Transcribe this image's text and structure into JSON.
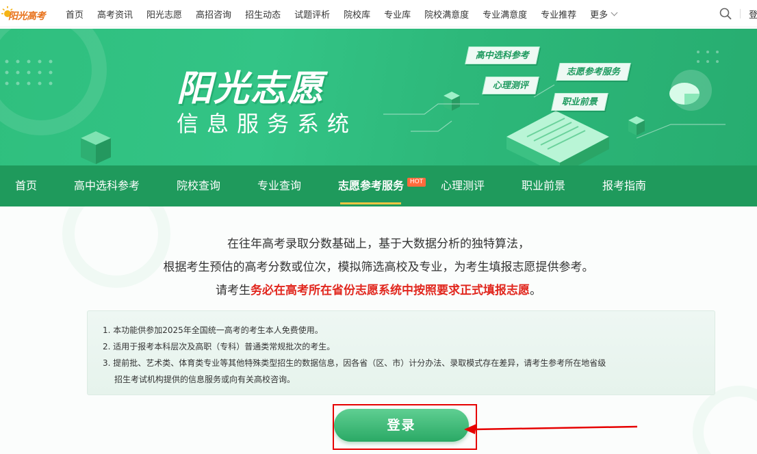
{
  "colors": {
    "brand_green": "#1f9a5c",
    "banner_green": "#33c486",
    "accent_yellow": "#f6c343",
    "hot_orange": "#ff6b3d",
    "warning_red": "#e1271e",
    "annotation_red": "#e60000"
  },
  "topbar": {
    "logo_text": "阳光高考",
    "nav": [
      "首页",
      "高考资讯",
      "阳光志愿",
      "高招咨询",
      "招生动态",
      "试题评析",
      "院校库",
      "专业库",
      "院校满意度",
      "专业满意度",
      "专业推荐"
    ],
    "more_label": "更多",
    "more_icon": "chevron-down-icon",
    "search_icon": "search-icon",
    "login_label": "登"
  },
  "banner": {
    "title": "阳光志愿",
    "subtitle": "信息服务系统",
    "tags": [
      "高中选科参考",
      "心理测评",
      "志愿参考服务",
      "职业前景"
    ]
  },
  "mainnav": {
    "items": [
      "首页",
      "高中选科参考",
      "院校查询",
      "专业查询",
      "志愿参考服务",
      "心理测评",
      "职业前景",
      "报考指南"
    ],
    "active_index": 4,
    "hot_badge": "HOT"
  },
  "content": {
    "intro_line1": "在往年高考录取分数基础上，基于大数据分析的独特算法，",
    "intro_line2": "根据考生预估的高考分数或位次，模拟筛选高校及专业，为考生填报志愿提供参考。",
    "intro_line3_prefix": "请考生",
    "intro_line3_warning": "务必在高考所在省份志愿系统中按照要求正式填报志愿",
    "intro_line3_suffix": "。",
    "notes": [
      "1. 本功能供参加2025年全国统一高考的考生本人免费使用。",
      "2. 适用于报考本科层次及高职（专科）普通类常规批次的考生。",
      "3. 提前批、艺术类、体育类专业等其他特殊类型招生的数据信息，因各省（区、市）计分办法、录取模式存在差异，请考生参考所在地省级",
      "招生考试机构提供的信息服务或向有关高校咨询。"
    ],
    "login_button": "登录"
  }
}
